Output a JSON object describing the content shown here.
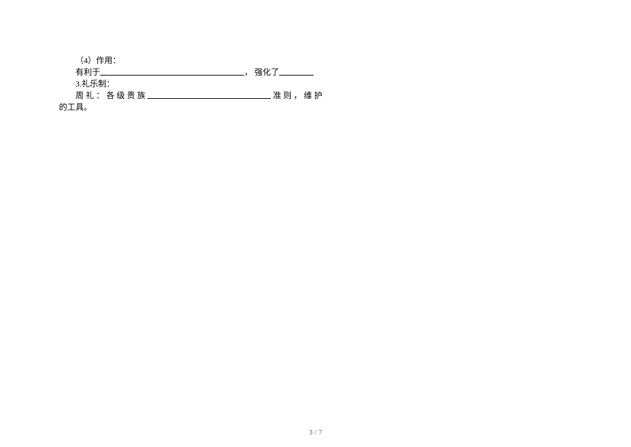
{
  "lines": {
    "l1": "（4）作用：",
    "l2_prefix": "有利于",
    "l2_mid": "， 强化了",
    "l3": "3.礼乐制：",
    "l4_prefix": "周 礼 ： 各 级 贵 族 ",
    "l4_suffix_a": " 准 则 ， 维 护 ",
    "l5": "的工具。"
  },
  "footer": {
    "page": "3 / 7"
  }
}
